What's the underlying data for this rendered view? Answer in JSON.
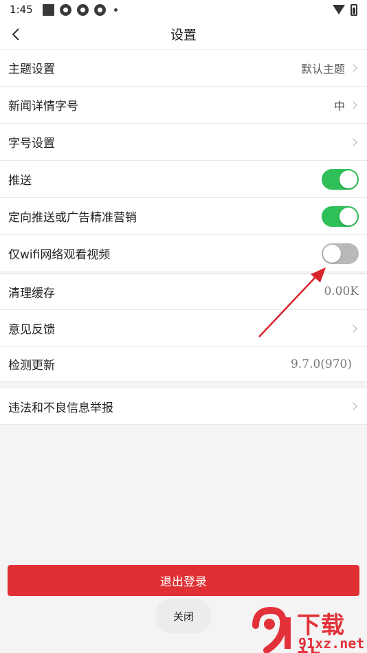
{
  "status_bar": {
    "time": "1:45"
  },
  "header": {
    "title": "设置"
  },
  "rows": [
    {
      "label": "主题设置",
      "value": "默认主题"
    },
    {
      "label": "新闻详情字号",
      "value": "中"
    },
    {
      "label": "字号设置",
      "value": ""
    },
    {
      "label": "推送",
      "toggle": "on"
    },
    {
      "label": "定向推送或广告精准营销",
      "toggle": "on"
    },
    {
      "label": "仅wifi网络观看视频",
      "toggle": "off"
    },
    {
      "label": "清理缓存",
      "value": "0.00K"
    },
    {
      "label": "意见反馈",
      "value": ""
    },
    {
      "label": "检测更新",
      "value": "9.7.0(970)"
    },
    {
      "label": "违法和不良信息举报",
      "value": ""
    }
  ],
  "logout_button": {
    "label": "退出登录"
  },
  "toast": {
    "label": "关闭"
  },
  "watermark": {
    "text": "下载站",
    "url": "91xz.net"
  },
  "colors": {
    "toggle_on": "#2fbf58",
    "toggle_off": "#b9b9b9",
    "logout": "#e03034",
    "arrow": "#d8232a"
  }
}
